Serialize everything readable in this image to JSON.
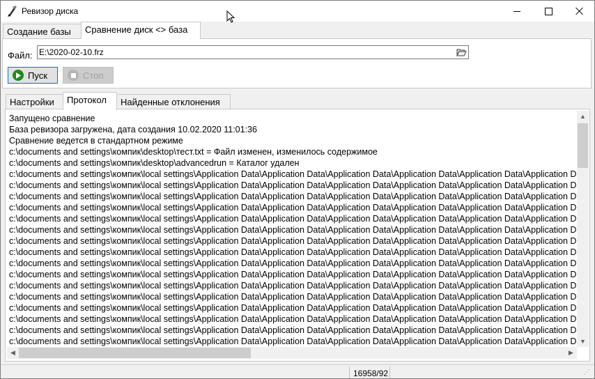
{
  "window": {
    "title": "Ревизор диска",
    "icon": "quill-pen-icon"
  },
  "main_tabs": [
    {
      "label": "Создание базы",
      "active": false
    },
    {
      "label": "Сравнение диск <> база",
      "active": true
    }
  ],
  "file": {
    "label": "Файл:",
    "value": "E:\\2020-02-10.frz",
    "browse_icon": "folder-open-icon"
  },
  "buttons": {
    "start_label": "Пуск",
    "stop_label": "Стоп"
  },
  "inner_tabs": [
    {
      "label": "Настройки",
      "active": false
    },
    {
      "label": "Протокол",
      "active": true
    },
    {
      "label": "Найденные отклонения",
      "active": false
    }
  ],
  "log": {
    "lines": [
      "Запущено сравнение",
      "База ревизора загружена, дата создания 10.02.2020 11:01:36",
      "Сравнение ведется в стандартном режиме",
      "c:\\documents and settings\\компик\\desktop\\тест.txt = Файл изменен, изменилось содержимое",
      "c:\\documents and settings\\компик\\desktop\\advancedrun = Каталог удален",
      "c:\\documents and settings\\компик\\local settings\\Application Data\\Application Data\\Application Data\\Application Data\\Application Data\\Application Data",
      "c:\\documents and settings\\компик\\local settings\\Application Data\\Application Data\\Application Data\\Application Data\\Application Data\\Application Data",
      "c:\\documents and settings\\компик\\local settings\\Application Data\\Application Data\\Application Data\\Application Data\\Application Data\\Application Data",
      "c:\\documents and settings\\компик\\local settings\\Application Data\\Application Data\\Application Data\\Application Data\\Application Data\\Application Data",
      "c:\\documents and settings\\компик\\local settings\\Application Data\\Application Data\\Application Data\\Application Data\\Application Data\\Application Data",
      "c:\\documents and settings\\компик\\local settings\\Application Data\\Application Data\\Application Data\\Application Data\\Application Data\\Application Data",
      "c:\\documents and settings\\компик\\local settings\\Application Data\\Application Data\\Application Data\\Application Data\\Application Data\\Application Data",
      "c:\\documents and settings\\компик\\local settings\\Application Data\\Application Data\\Application Data\\Application Data\\Application Data\\Application Data",
      "c:\\documents and settings\\компик\\local settings\\Application Data\\Application Data\\Application Data\\Application Data\\Application Data\\Application Data",
      "c:\\documents and settings\\компик\\local settings\\Application Data\\Application Data\\Application Data\\Application Data\\Application Data\\Application Data",
      "c:\\documents and settings\\компик\\local settings\\Application Data\\Application Data\\Application Data\\Application Data\\Application Data\\Application Data",
      "c:\\documents and settings\\компик\\local settings\\Application Data\\Application Data\\Application Data\\Application Data\\Application Data\\Application Data",
      "c:\\documents and settings\\компик\\local settings\\Application Data\\Application Data\\Application Data\\Application Data\\Application Data\\Application Data",
      "c:\\documents and settings\\компик\\local settings\\Application Data\\Application Data\\Application Data\\Application Data\\Application Data\\Application Data",
      "c:\\documents and settings\\компик\\local settings\\Application Data\\Application Data\\Application Data\\Application Data\\Application Data\\Application Data",
      "c:\\documents and settings\\компик\\local settings\\Application Data\\Application Data\\Application Data\\Application Data\\Application Data\\Application Data",
      "c:\\documents and settings\\компик\\local settings\\Application Data\\Application Data\\Application Data\\Application Data\\Application Data\\Application Data",
      "c:\\documents and settings\\компик\\local settings\\Application Data\\Application Data\\Application Data\\Application Data\\Application Data\\Application Data"
    ]
  },
  "status": {
    "count": "16958/92"
  },
  "colors": {
    "start_icon": "#1e8b1e",
    "accent_border": "#0078d7"
  }
}
